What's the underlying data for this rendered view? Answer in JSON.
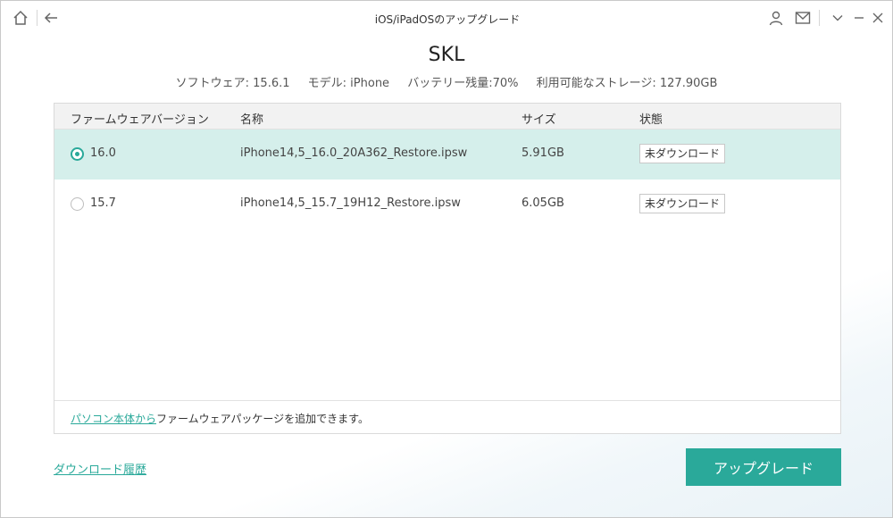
{
  "titlebar": {
    "title": "iOS/iPadOSのアップグレード",
    "icons": [
      "home-icon",
      "back-arrow-icon",
      "user-icon",
      "mail-icon",
      "chevron-down-icon",
      "minimize-icon",
      "close-icon"
    ]
  },
  "device": {
    "name": "SKL",
    "software": "ソフトウェア: 15.6.1",
    "model": "モデル: iPhone",
    "battery": "バッテリー残量:70%",
    "storage": "利用可能なストレージ: 127.90GB"
  },
  "table": {
    "headers": [
      "ファームウェアバージョン",
      "名称",
      "サイズ",
      "状態"
    ],
    "rows": [
      {
        "version": "16.0",
        "name": "iPhone14,5_16.0_20A362_Restore.ipsw",
        "size": "5.91GB",
        "status": "未ダウンロード",
        "selected": true
      },
      {
        "version": "15.7",
        "name": "iPhone14,5_15.7_19H12_Restore.ipsw",
        "size": "6.05GB",
        "status": "未ダウンロード",
        "selected": false
      }
    ],
    "footer_link": "パソコン本体から",
    "footer_text": "ファームウェアパッケージを追加できます。"
  },
  "history_link": "ダウンロード履歴",
  "upgrade_button": "アップグレード",
  "colors": {
    "accent": "#2aa99a",
    "selected_row": "#d5efeb"
  }
}
